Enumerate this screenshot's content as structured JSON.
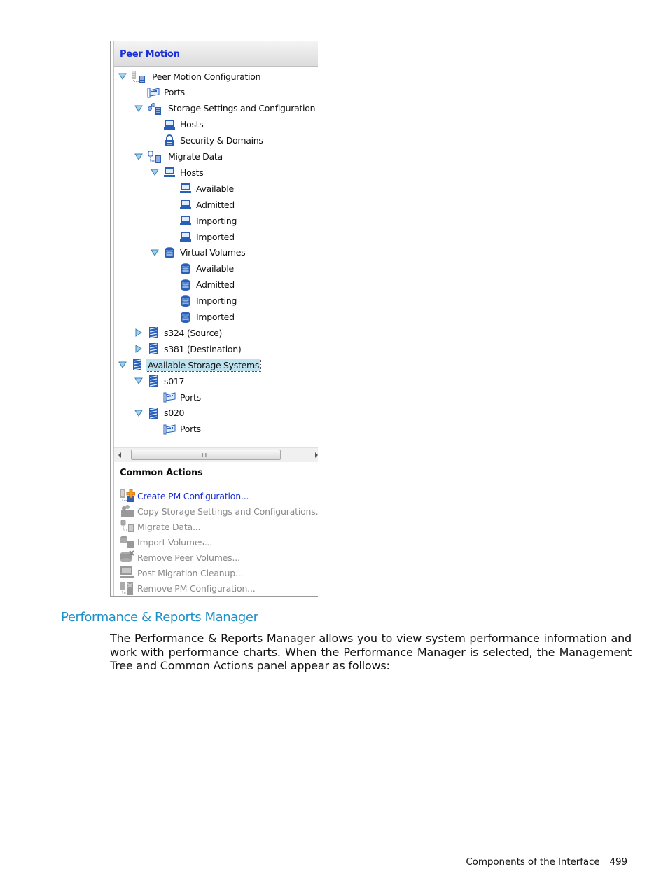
{
  "panel": {
    "title": "Peer Motion",
    "tree": [
      {
        "label": "Peer Motion Configuration",
        "icon": "pm-config-icon",
        "depth": 0,
        "expander": "expanded"
      },
      {
        "label": "Ports",
        "icon": "ports-icon",
        "depth": 1,
        "expander": "none"
      },
      {
        "label": "Storage Settings and Configuration",
        "icon": "storage-settings-icon",
        "depth": 1,
        "expander": "expanded"
      },
      {
        "label": "Hosts",
        "icon": "host-icon",
        "depth": 2,
        "expander": "none"
      },
      {
        "label": "Security & Domains",
        "icon": "lock-icon",
        "depth": 2,
        "expander": "none"
      },
      {
        "label": "Migrate Data",
        "icon": "migrate-data-icon",
        "depth": 1,
        "expander": "expanded"
      },
      {
        "label": "Hosts",
        "icon": "host-icon",
        "depth": 2,
        "expander": "expanded"
      },
      {
        "label": "Available",
        "icon": "host-icon",
        "depth": 3,
        "expander": "none"
      },
      {
        "label": "Admitted",
        "icon": "host-icon",
        "depth": 3,
        "expander": "none"
      },
      {
        "label": "Importing",
        "icon": "host-icon",
        "depth": 3,
        "expander": "none"
      },
      {
        "label": "Imported",
        "icon": "host-icon",
        "depth": 3,
        "expander": "none"
      },
      {
        "label": "Virtual Volumes",
        "icon": "volume-icon",
        "depth": 2,
        "expander": "expanded"
      },
      {
        "label": "Available",
        "icon": "volume-icon",
        "depth": 3,
        "expander": "none"
      },
      {
        "label": "Admitted",
        "icon": "volume-icon",
        "depth": 3,
        "expander": "none"
      },
      {
        "label": "Importing",
        "icon": "volume-icon",
        "depth": 3,
        "expander": "none"
      },
      {
        "label": "Imported",
        "icon": "volume-icon",
        "depth": 3,
        "expander": "none"
      },
      {
        "label": "s324 (Source)",
        "icon": "storage-system-icon",
        "depth": 1,
        "expander": "collapsed"
      },
      {
        "label": "s381 (Destination)",
        "icon": "storage-system-icon",
        "depth": 1,
        "expander": "collapsed"
      },
      {
        "label": "Available Storage Systems",
        "icon": "storage-system-icon",
        "depth": 0,
        "expander": "expanded",
        "selected": true
      },
      {
        "label": "s017",
        "icon": "storage-system-icon",
        "depth": 1,
        "expander": "expanded"
      },
      {
        "label": "Ports",
        "icon": "ports-icon",
        "depth": 2,
        "expander": "none"
      },
      {
        "label": "s020",
        "icon": "storage-system-icon",
        "depth": 1,
        "expander": "expanded"
      },
      {
        "label": "Ports",
        "icon": "ports-icon",
        "depth": 2,
        "expander": "none"
      }
    ],
    "scrollbar_grip": "III",
    "common_actions": {
      "title": "Common Actions",
      "items": [
        {
          "label": "Create PM Configuration...",
          "icon": "create-config-icon",
          "enabled": true
        },
        {
          "label": "Copy Storage Settings and Configurations...",
          "icon": "copy-settings-icon",
          "enabled": false
        },
        {
          "label": "Migrate Data...",
          "icon": "migrate-data-icon",
          "enabled": false
        },
        {
          "label": "Import Volumes...",
          "icon": "import-volumes-icon",
          "enabled": false
        },
        {
          "label": "Remove Peer Volumes...",
          "icon": "remove-volumes-icon",
          "enabled": false
        },
        {
          "label": "Post Migration Cleanup...",
          "icon": "cleanup-icon",
          "enabled": false
        },
        {
          "label": "Remove PM Configuration...",
          "icon": "remove-config-icon",
          "enabled": false
        }
      ]
    }
  },
  "document": {
    "section_title": "Performance & Reports Manager",
    "body": "The Performance & Reports Manager allows you to view system performance information and work with performance charts. When the Performance Manager is selected, the Management Tree and Common Actions panel appear as follows:",
    "footer_text": "Components of the Interface",
    "page_number": "499"
  },
  "colors": {
    "link_blue": "#1a2fd8",
    "heading_blue": "#1e90c8",
    "selection": "#bfe3ee",
    "disabled_text": "#8a8a8a"
  }
}
